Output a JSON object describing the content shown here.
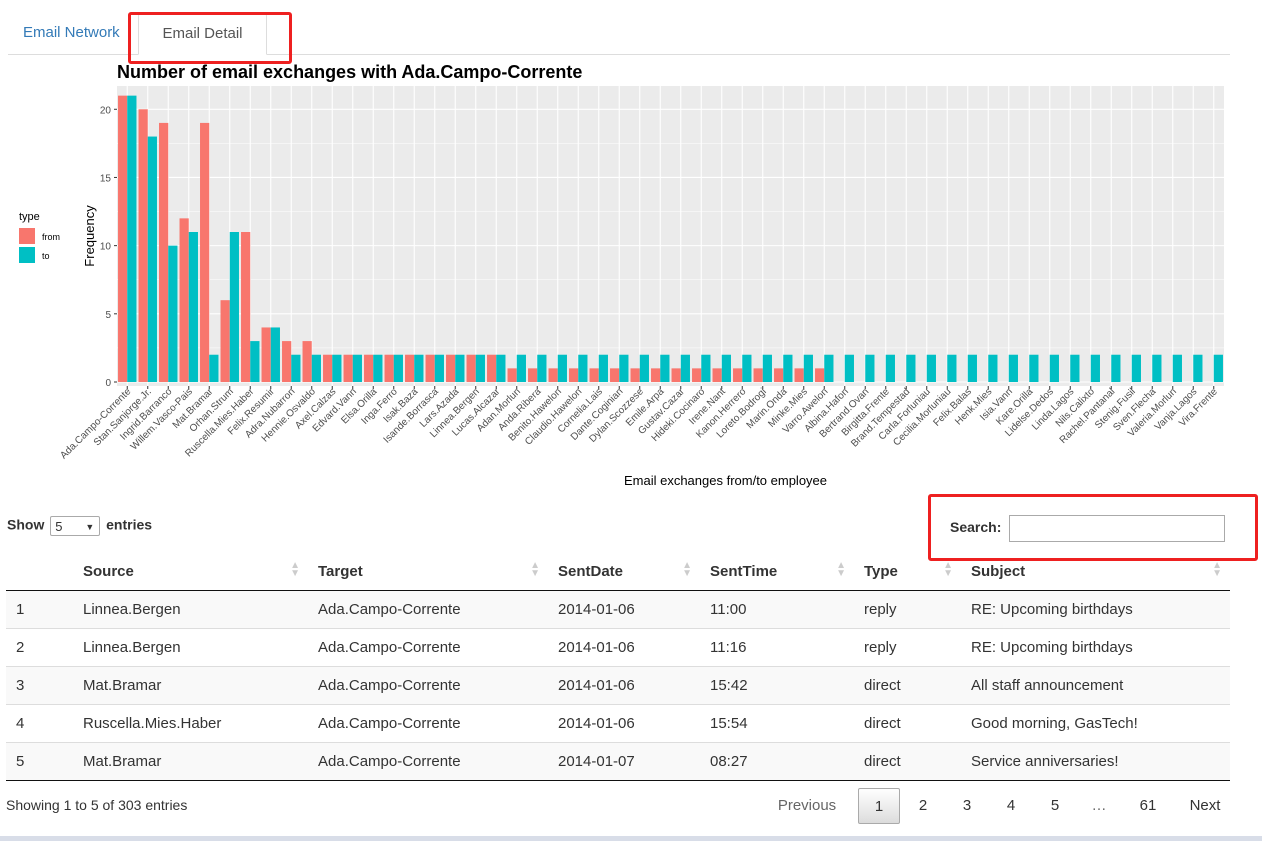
{
  "tabs": [
    {
      "label": "Email Network"
    },
    {
      "label": "Email Detail"
    }
  ],
  "colors": {
    "from": "#f8766d",
    "to": "#00bfc4",
    "panel": "#ebebeb",
    "highlight": "#ee2020",
    "link": "#337ab7"
  },
  "chart_data": {
    "type": "bar",
    "title": "Number of email exchanges with Ada.Campo-Corrente",
    "xlabel": "Email exchanges from/to employee",
    "ylabel": "Frequency",
    "ylim": [
      0,
      22
    ],
    "yticks": [
      0,
      5,
      10,
      15,
      20
    ],
    "legend": {
      "title": "type",
      "position": "left"
    },
    "grid": true,
    "categories": [
      "Ada.Campo-Corrente",
      "Stan.Sanjorge.Jr.",
      "Ingrid.Barranco",
      "Willem.Vasco-Pais",
      "Mat.Bramar",
      "Orhan.Strum",
      "Ruscella.Mies.Haber",
      "Felix.Resumir",
      "Adra.Nubarron",
      "Hennie.Osvaldo",
      "Axel.Calzas",
      "Edvard.Vann",
      "Elsa.Orilla",
      "Inga.Ferro",
      "Isak.Baza",
      "Isande.Borrasca",
      "Lars.Azada",
      "Linnea.Bergen",
      "Lucas.Alcazar",
      "Adan.Morlun",
      "Anda.Ribera",
      "Benito.Hawelon",
      "Claudio.Hawelon",
      "Cornelia.Lais",
      "Dante.Coginian",
      "Dylan.Scozzese",
      "Emile.Arpa",
      "Gustav.Cazar",
      "Hideki.Cocinaro",
      "Irene.Nant",
      "Kanon.Herrero",
      "Loreto.Bodrogi",
      "Marin.Onda",
      "Minke.Mies",
      "Varro.Awelon",
      "Albina.Hafon",
      "Bertrand.Ovan",
      "Birgitta.Frente",
      "Brand.Tempestad",
      "Carla.Forluniau",
      "Cecilia.Morluniau",
      "Felix.Balas",
      "Henk.Mies",
      "Isia.Vann",
      "Kare.Orilla",
      "Lidelse.Dedos",
      "Linda.Lagos",
      "Nils.Calixto",
      "Rachel.Pantanal",
      "Stenig.Fusil",
      "Sven.Flecha",
      "Valeria.Morlun",
      "Vanja.Lagos",
      "Vira.Frente"
    ],
    "series": [
      {
        "name": "from",
        "values": [
          21,
          20,
          19,
          12,
          19,
          6,
          11,
          4,
          3,
          3,
          2,
          2,
          2,
          2,
          2,
          2,
          2,
          2,
          2,
          1,
          1,
          1,
          1,
          1,
          1,
          1,
          1,
          1,
          1,
          1,
          1,
          1,
          1,
          1,
          1,
          0,
          0,
          0,
          0,
          0,
          0,
          0,
          0,
          0,
          0,
          0,
          0,
          0,
          0,
          0,
          0,
          0,
          0,
          0
        ]
      },
      {
        "name": "to",
        "values": [
          21,
          18,
          10,
          11,
          2,
          11,
          3,
          4,
          2,
          2,
          2,
          2,
          2,
          2,
          2,
          2,
          2,
          2,
          2,
          2,
          2,
          2,
          2,
          2,
          2,
          2,
          2,
          2,
          2,
          2,
          2,
          2,
          2,
          2,
          2,
          2,
          2,
          2,
          2,
          2,
          2,
          2,
          2,
          2,
          2,
          2,
          2,
          2,
          2,
          2,
          2,
          2,
          2,
          2
        ]
      }
    ]
  },
  "table_controls": {
    "show_label": "Show",
    "entries_value": "5",
    "entries_label": "entries",
    "search_label": "Search:"
  },
  "table": {
    "columns": [
      "",
      "Source",
      "Target",
      "SentDate",
      "SentTime",
      "Type",
      "Subject"
    ],
    "rows": [
      [
        "1",
        "Linnea.Bergen",
        "Ada.Campo-Corrente",
        "2014-01-06",
        "11:00",
        "reply",
        "RE: Upcoming birthdays"
      ],
      [
        "2",
        "Linnea.Bergen",
        "Ada.Campo-Corrente",
        "2014-01-06",
        "11:16",
        "reply",
        "RE: Upcoming birthdays"
      ],
      [
        "3",
        "Mat.Bramar",
        "Ada.Campo-Corrente",
        "2014-01-06",
        "15:42",
        "direct",
        "All staff announcement"
      ],
      [
        "4",
        "Ruscella.Mies.Haber",
        "Ada.Campo-Corrente",
        "2014-01-06",
        "15:54",
        "direct",
        "Good morning, GasTech!"
      ],
      [
        "5",
        "Mat.Bramar",
        "Ada.Campo-Corrente",
        "2014-01-07",
        "08:27",
        "direct",
        "Service anniversaries!"
      ]
    ]
  },
  "info": "Showing 1 to 5 of 303 entries",
  "pagination": {
    "previous": "Previous",
    "pages": [
      "1",
      "2",
      "3",
      "4",
      "5",
      "…",
      "61"
    ],
    "current": "1",
    "next": "Next"
  }
}
